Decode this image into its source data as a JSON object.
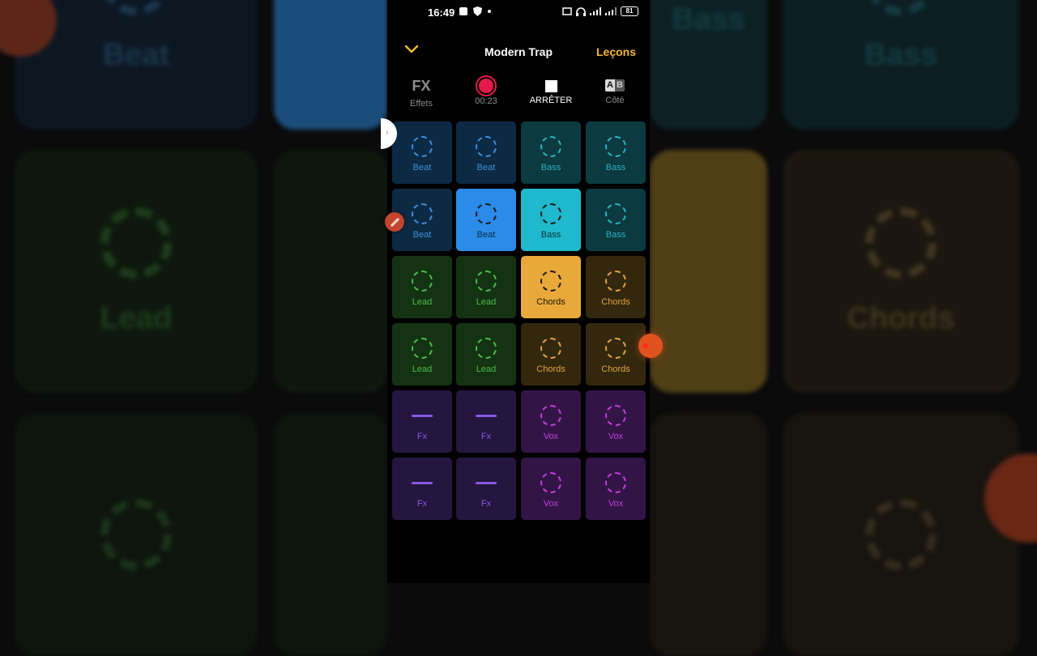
{
  "status_bar": {
    "time": "16:49",
    "battery": "81"
  },
  "header": {
    "title": "Modern Trap",
    "lessons_label": "Leçons"
  },
  "toolbar": {
    "fx_icon": "FX",
    "fx_label": "Effets",
    "timer": "00:23",
    "stop_label": "ARRÊTER",
    "side_a": "A",
    "side_b": "B",
    "side_label": "Côté"
  },
  "pads": [
    [
      "Beat",
      "Beat",
      "Bass",
      "Bass"
    ],
    [
      "Beat",
      "Beat",
      "Bass",
      "Bass"
    ],
    [
      "Lead",
      "Lead",
      "Chords",
      "Chords"
    ],
    [
      "Lead",
      "Lead",
      "Chords",
      "Chords"
    ],
    [
      "Fx",
      "Fx",
      "Vox",
      "Vox"
    ],
    [
      "Fx",
      "Fx",
      "Vox",
      "Vox"
    ]
  ],
  "active_pads": [
    "1-1",
    "1-2",
    "2-2"
  ],
  "background_labels": {
    "beat": "Beat",
    "bass": "Bass",
    "lead": "Lead",
    "chords": "Chords"
  },
  "colors": {
    "beat": "#2a8be8",
    "bass": "#1fb8cc",
    "lead": "#45b84a",
    "chords": "#e9a93a",
    "fx": "#8a4fe0",
    "vox": "#c53ad8",
    "lessons": "#f5b731",
    "record": "#e5194a"
  }
}
